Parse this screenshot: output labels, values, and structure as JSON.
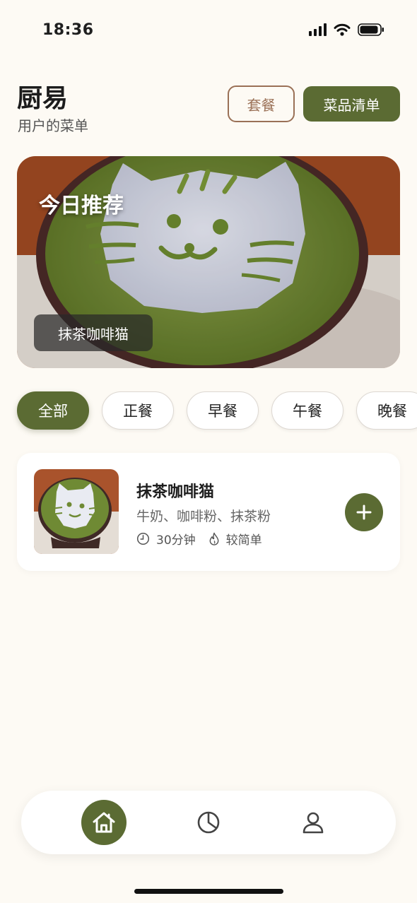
{
  "status_bar": {
    "time": "18:36",
    "icons": [
      "signal-icon",
      "wifi-icon",
      "battery-icon"
    ]
  },
  "header": {
    "title": "厨易",
    "subtitle": "用户的菜单",
    "set_button_label": "套餐",
    "list_button_label": "菜品清单"
  },
  "hero": {
    "heading": "今日推荐",
    "dish_name": "抹茶咖啡猫"
  },
  "categories": [
    {
      "label": "全部",
      "active": true
    },
    {
      "label": "正餐",
      "active": false
    },
    {
      "label": "早餐",
      "active": false
    },
    {
      "label": "午餐",
      "active": false
    },
    {
      "label": "晚餐",
      "active": false
    }
  ],
  "recipes": [
    {
      "name": "抹茶咖啡猫",
      "ingredients": "牛奶、咖啡粉、抹茶粉",
      "time": "30分钟",
      "difficulty": "较简单",
      "time_icon": "clock-icon",
      "difficulty_icon": "flame-icon"
    }
  ],
  "bottom_nav": [
    {
      "name": "home",
      "icon": "home-icon",
      "active": true
    },
    {
      "name": "stats",
      "icon": "pie-chart-icon",
      "active": false
    },
    {
      "name": "profile",
      "icon": "user-icon",
      "active": false
    }
  ],
  "colors": {
    "background": "#fdfaf4",
    "primary": "#5b6b33",
    "secondary": "#9a7056",
    "card": "#ffffff"
  }
}
